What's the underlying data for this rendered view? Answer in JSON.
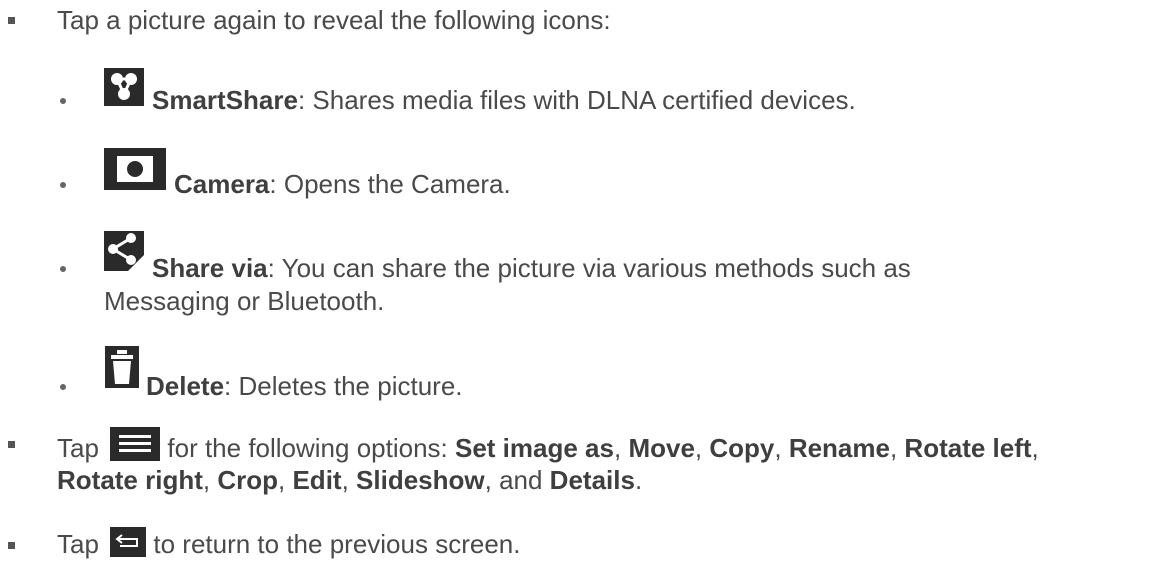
{
  "intro": "Tap a picture again to reveal the following icons:",
  "items": [
    {
      "icon": "smartshare-icon",
      "label": "SmartShare",
      "desc": ": Shares media files with DLNA certified devices."
    },
    {
      "icon": "camera-icon",
      "label": "Camera",
      "desc": ": Opens the Camera."
    },
    {
      "icon": "share-icon",
      "label": "Share via",
      "desc": ": You can share the picture via various methods such as",
      "desc2": "Messaging or Bluetooth."
    },
    {
      "icon": "trash-icon",
      "label": "Delete",
      "desc": ": Deletes the picture."
    }
  ],
  "menu_line": {
    "pre": "Tap",
    "mid": " for the following options: ",
    "opts": [
      "Set image as",
      "Move",
      "Copy",
      "Rename",
      "Rotate left",
      "Rotate right",
      "Crop",
      "Edit",
      "Slideshow",
      "Details"
    ],
    "sep": ", ",
    "and": "and ",
    "end": "."
  },
  "back_line": {
    "pre": "Tap",
    "post": " to return to the previous screen."
  },
  "icons": {
    "menu": "menu-icon",
    "back": "back-icon"
  }
}
